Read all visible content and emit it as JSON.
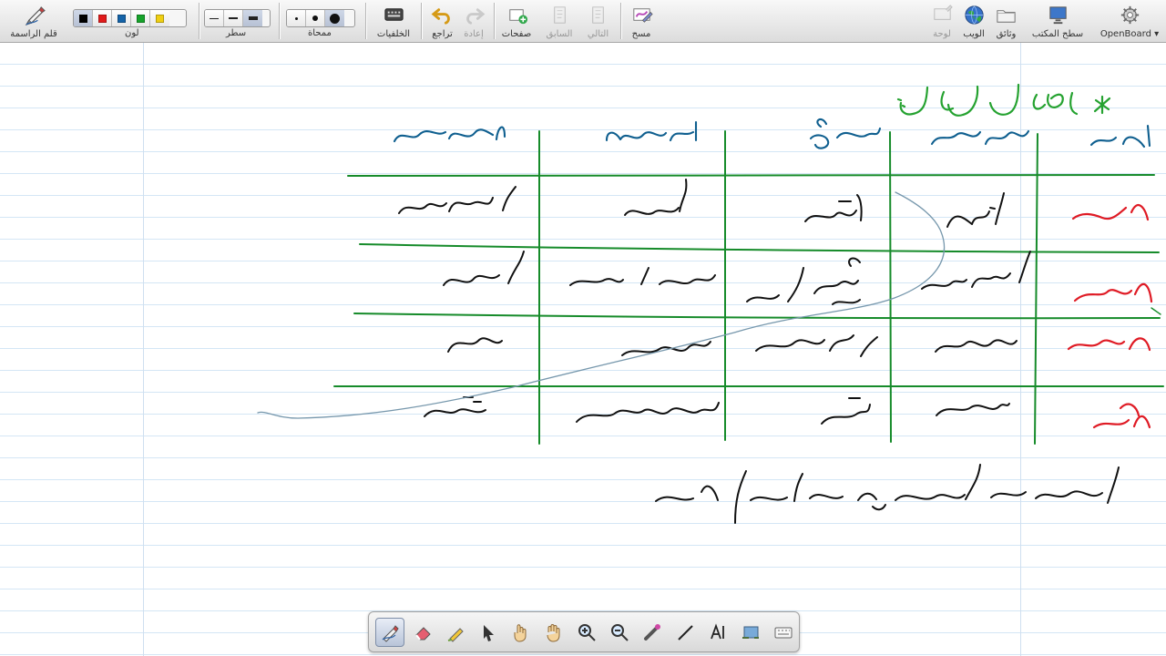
{
  "app": {
    "name": "OpenBoard"
  },
  "toolbar": {
    "pen": {
      "label": "قلم الراسمة",
      "icon": "marker-pen-icon"
    },
    "color": {
      "label": "لون",
      "options": [
        {
          "name": "black-color-option",
          "hex": "#000000",
          "selected": true
        },
        {
          "name": "red-color-option",
          "hex": "#e11b1b",
          "selected": false
        },
        {
          "name": "blue-color-option",
          "hex": "#1463a8",
          "selected": false
        },
        {
          "name": "green-color-option",
          "hex": "#17a32b",
          "selected": false
        },
        {
          "name": "yellow-color-option",
          "hex": "#efcf13",
          "selected": false
        }
      ]
    },
    "line": {
      "label": "سطر",
      "options": [
        "thin-line-option",
        "medium-line-option",
        "thick-line-option"
      ]
    },
    "eraser_size": {
      "label": "ممحاة",
      "options": [
        "small-eraser-option",
        "medium-eraser-option",
        "large-eraser-option"
      ]
    },
    "background": {
      "label": "الخلفيات",
      "icon": "keyboard-background-icon"
    },
    "undo": {
      "label": "تراجع",
      "icon": "undo-icon"
    },
    "redo": {
      "label": "إعادة",
      "icon": "redo-icon"
    },
    "pages": {
      "label": "صفحات",
      "icon": "add-page-icon"
    },
    "previous": {
      "label": "السابق",
      "icon": "previous-page-icon"
    },
    "next": {
      "label": "التالي",
      "icon": "next-page-icon"
    },
    "clear": {
      "label": "مسح",
      "icon": "clear-icon"
    },
    "board": {
      "label": "لوحة",
      "icon": "board-icon"
    },
    "web": {
      "label": "الويب",
      "icon": "web-globe-icon"
    },
    "documents": {
      "label": "وثائق",
      "icon": "documents-folder-icon"
    },
    "desktop": {
      "label": "سطح المكتب",
      "icon": "desktop-icon"
    },
    "openboard": {
      "label": "OpenBoard",
      "icon": "settings-gear-icon"
    }
  },
  "colors": {
    "table_green": "#168b2a",
    "title_green": "#25a230",
    "header_blue": "#0f5f8f",
    "animal_red": "#df1b25",
    "ink_black": "#111111",
    "connector_blue": "#7697ac"
  },
  "dock": {
    "items": [
      {
        "icon": "pen-tool-icon",
        "active": true
      },
      {
        "icon": "eraser-tool-icon",
        "active": false
      },
      {
        "icon": "highlighter-tool-icon",
        "active": false
      },
      {
        "icon": "selection-arrow-icon",
        "active": false
      },
      {
        "icon": "interact-hand-icon",
        "active": false
      },
      {
        "icon": "pan-hand-icon",
        "active": false
      },
      {
        "icon": "zoom-in-icon",
        "active": false
      },
      {
        "icon": "zoom-out-icon",
        "active": false
      },
      {
        "icon": "laser-pointer-icon",
        "active": false
      },
      {
        "icon": "line-tool-icon",
        "active": false
      },
      {
        "icon": "text-tool-icon",
        "active": false
      },
      {
        "icon": "capture-tool-icon",
        "active": false
      },
      {
        "icon": "virtual-keyboard-icon",
        "active": false
      }
    ]
  }
}
